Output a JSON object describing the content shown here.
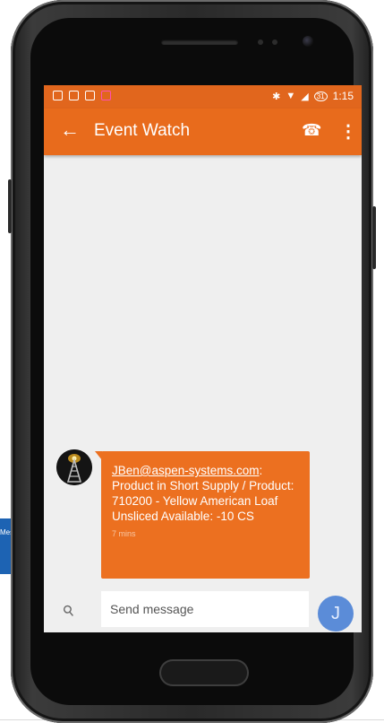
{
  "background": {
    "card_text": "Message"
  },
  "status_bar": {
    "time": "1:15",
    "battery_badge": "31",
    "icons": [
      "photo-icon",
      "photo-icon",
      "image-icon",
      "game-icon",
      "bluetooth-icon",
      "wifi-icon",
      "signal-icon",
      "battery-icon"
    ]
  },
  "app_bar": {
    "back_label": "←",
    "title": "Event Watch",
    "call_label": "☎",
    "more_label": "⋮"
  },
  "message": {
    "sender": "JBen@aspen-systems.com",
    "separator": ":",
    "body": "Product in Short Supply / Product: 710200 - Yellow American Loaf Unsliced Available: -10 CS",
    "time": "7 mins"
  },
  "composer": {
    "placeholder": "Send message",
    "send_initial": "J",
    "attach_label": "⚲"
  },
  "colors": {
    "accent": "#e86b1c",
    "status_bar": "#e1661d",
    "bubble": "#ec7020",
    "send_button": "#5b8cd8"
  }
}
